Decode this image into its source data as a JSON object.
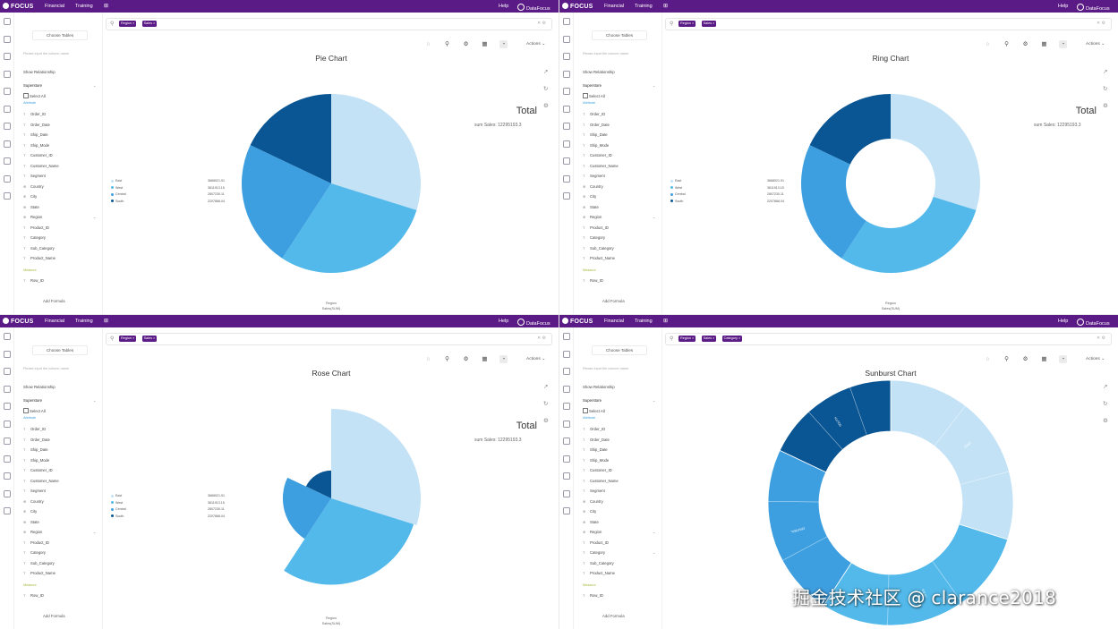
{
  "app": {
    "logo_text": "FOCUS",
    "nav": [
      "Financial",
      "Training"
    ],
    "help_label": "Help",
    "user_name": "DataFocus"
  },
  "sidebar": {
    "choose_tables_label": "Choose Tables",
    "search_placeholder": "Please input the column name",
    "show_relationship_label": "Show Relationship",
    "table_name": "Superstore",
    "select_all_label": "Select All",
    "attribute_label": "Attribute",
    "measure_label": "Measure",
    "add_formula_label": "Add Formula",
    "attribute_fields": [
      {
        "icon": "T",
        "label": "Order_ID"
      },
      {
        "icon": "T",
        "label": "Order_Date"
      },
      {
        "icon": "T",
        "label": "Ship_Date"
      },
      {
        "icon": "T",
        "label": "Ship_Mode"
      },
      {
        "icon": "T",
        "label": "Customer_ID"
      },
      {
        "icon": "T",
        "label": "Customer_Name"
      },
      {
        "icon": "T",
        "label": "Segment"
      },
      {
        "icon": "globe",
        "label": "Country"
      },
      {
        "icon": "globe",
        "label": "City"
      },
      {
        "icon": "globe",
        "label": "State"
      },
      {
        "icon": "globe",
        "label": "Region"
      },
      {
        "icon": "T",
        "label": "Product_ID"
      },
      {
        "icon": "T",
        "label": "Category"
      },
      {
        "icon": "T",
        "label": "Sub_Category"
      },
      {
        "icon": "T",
        "label": "Product_Name"
      }
    ],
    "measure_fields": [
      {
        "icon": "T",
        "label": "Row_ID"
      }
    ]
  },
  "actions_label": "Actions",
  "total_label": "Total",
  "sum_label": "sum Sales: 12295193.3",
  "watermark": "掘金技术社区 @ clarance2018",
  "colors": {
    "topbar": "#5b1b86",
    "East": "#c3e2f6",
    "West": "#53b9ea",
    "Central": "#3e9fe0",
    "South": "#0a5593"
  },
  "panels": [
    {
      "title": "Pie Chart",
      "search_tags": [
        "Region",
        "Sales"
      ],
      "x_label": "Region",
      "y_label": "Sales(SUM)"
    },
    {
      "title": "Ring Chart",
      "search_tags": [
        "Region",
        "Sales"
      ],
      "x_label": "Region",
      "y_label": "Sales(SUM)"
    },
    {
      "title": "Rose Chart",
      "search_tags": [
        "Region",
        "Sales"
      ],
      "x_label": "Region",
      "y_label": "Sales(SUM)"
    },
    {
      "title": "Sunburst Chart",
      "search_tags": [
        "Region",
        "Sales",
        "Category"
      ],
      "x_label": "",
      "y_label": ""
    }
  ],
  "chart_data": [
    {
      "type": "pie",
      "title": "Pie Chart",
      "categories": [
        "East",
        "West",
        "Central",
        "South"
      ],
      "values": [
        3668021.91,
        3611913.15,
        2807230.11,
        2207868.04
      ],
      "legend_position": "left"
    },
    {
      "type": "pie",
      "subtype": "ring",
      "title": "Ring Chart",
      "categories": [
        "East",
        "West",
        "Central",
        "South"
      ],
      "values": [
        3668021.91,
        3611913.15,
        2807230.11,
        2207868.04
      ],
      "legend_position": "left"
    },
    {
      "type": "pie",
      "subtype": "rose",
      "title": "Rose Chart",
      "categories": [
        "East",
        "West",
        "Central",
        "South"
      ],
      "values": [
        3668021.91,
        3611913.15,
        2807230.11,
        2207868.04
      ],
      "legend_position": "left"
    },
    {
      "type": "pie",
      "subtype": "sunburst",
      "title": "Sunburst Chart",
      "categories": [
        "East",
        "West",
        "Central",
        "South"
      ],
      "values": [
        3668021.91,
        3611913.15,
        2807230.11,
        2207868.04
      ],
      "outer_labels": [
        "",
        "WEST",
        "",
        "CENTRAL",
        "",
        "SOUTH",
        "",
        "EAST"
      ]
    }
  ]
}
